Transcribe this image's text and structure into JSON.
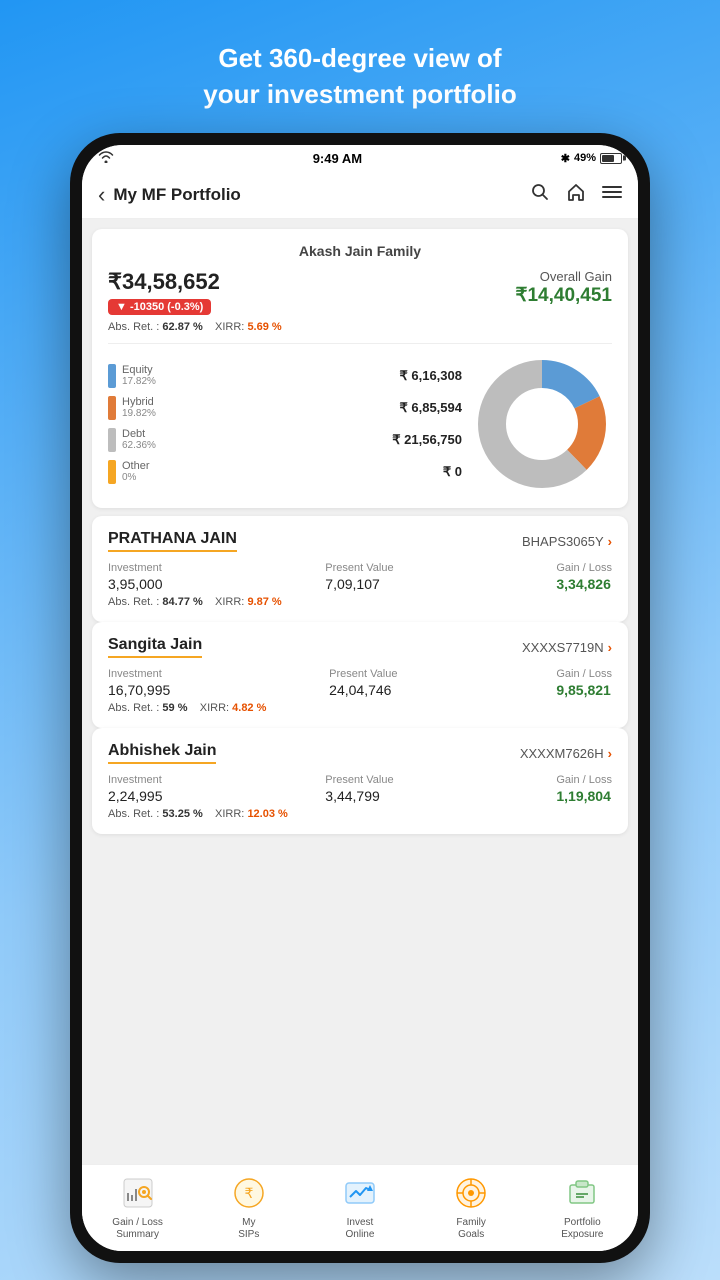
{
  "header": {
    "line1": "Get 360-degree view of",
    "line2": "your investment portfolio"
  },
  "statusBar": {
    "time": "9:49 AM",
    "battery": "49%"
  },
  "navBar": {
    "back": "‹",
    "title": "My MF Portfolio",
    "icons": [
      "search",
      "home",
      "menu"
    ]
  },
  "portfolioCard": {
    "familyName": "Akash Jain Family",
    "totalAmount": "₹34,58,652",
    "change": "▼ -10350  (-0.3%)",
    "absRet": "62.87 %",
    "xirr": "5.69 %",
    "overallGainLabel": "Overall Gain",
    "overallGainAmount": "₹14,40,451",
    "legend": [
      {
        "label": "Equity",
        "pct": "17.82%",
        "amount": "₹ 6,16,308",
        "color": "#5B9BD5"
      },
      {
        "label": "Hybrid",
        "pct": "19.82%",
        "amount": "₹ 6,85,594",
        "color": "#E07B39"
      },
      {
        "label": "Debt",
        "pct": "62.36%",
        "amount": "₹ 21,56,750",
        "color": "#BDBDBD"
      },
      {
        "label": "Other",
        "pct": "0%",
        "amount": "₹ 0",
        "color": "#F5A623"
      }
    ]
  },
  "members": [
    {
      "name": "PRATHANA JAIN",
      "id": "BHAPS3065Y",
      "investment": "3,95,000",
      "presentValue": "7,09,107",
      "gainLoss": "3,34,826",
      "absRet": "84.77 %",
      "xirr": "9.87 %"
    },
    {
      "name": "Sangita Jain",
      "id": "XXXXS7719N",
      "investment": "16,70,995",
      "presentValue": "24,04,746",
      "gainLoss": "9,85,821",
      "absRet": "59 %",
      "xirr": "4.82 %"
    },
    {
      "name": "Abhishek Jain",
      "id": "XXXXM7626H",
      "investment": "2,24,995",
      "presentValue": "3,44,799",
      "gainLoss": "1,19,804",
      "absRet": "53.25 %",
      "xirr": "12.03 %"
    }
  ],
  "bottomNav": [
    {
      "label": "Gain / Loss\nSummary",
      "icon": "chart-search"
    },
    {
      "label": "My\nSIPs",
      "icon": "sip"
    },
    {
      "label": "Invest\nOnline",
      "icon": "invest"
    },
    {
      "label": "Family\nGoals",
      "icon": "goals"
    },
    {
      "label": "Portfolio\nExposure",
      "icon": "exposure"
    }
  ],
  "labels": {
    "investment": "Investment",
    "presentValue": "Present Value",
    "gainLoss": "Gain / Loss",
    "absRet": "Abs. Ret. :",
    "xirr": "XIRR:"
  }
}
